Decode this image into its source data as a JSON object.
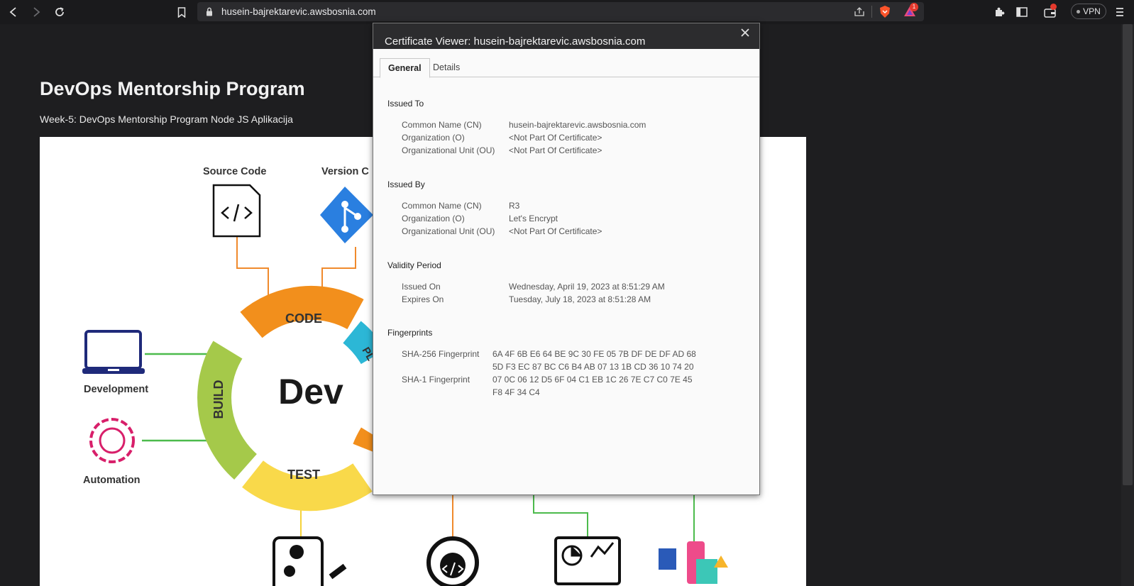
{
  "browser": {
    "url": "husein-bajrektarevic.awsbosnia.com",
    "notification_count": "1",
    "vpn_label": "VPN"
  },
  "page": {
    "title": "DevOps Mentorship Program",
    "subtitle": "Week-5: DevOps Mentorship Program Node JS Aplikacija"
  },
  "diagram": {
    "center_label": "Dev",
    "ring_labels": [
      "CODE",
      "BUILD",
      "TEST",
      "PL"
    ],
    "nodes": [
      "Source Code",
      "Version C",
      "Development",
      "Automation"
    ]
  },
  "certificate": {
    "title": "Certificate Viewer: husein-bajrektarevic.awsbosnia.com",
    "tabs": [
      "General",
      "Details"
    ],
    "issued_to": {
      "heading": "Issued To",
      "rows": [
        {
          "label": "Common Name (CN)",
          "value": "husein-bajrektarevic.awsbosnia.com"
        },
        {
          "label": "Organization (O)",
          "value": "<Not Part Of Certificate>"
        },
        {
          "label": "Organizational Unit (OU)",
          "value": "<Not Part Of Certificate>"
        }
      ]
    },
    "issued_by": {
      "heading": "Issued By",
      "rows": [
        {
          "label": "Common Name (CN)",
          "value": "R3"
        },
        {
          "label": "Organization (O)",
          "value": "Let's Encrypt"
        },
        {
          "label": "Organizational Unit (OU)",
          "value": "<Not Part Of Certificate>"
        }
      ]
    },
    "validity": {
      "heading": "Validity Period",
      "rows": [
        {
          "label": "Issued On",
          "value": "Wednesday, April 19, 2023 at 8:51:29 AM"
        },
        {
          "label": "Expires On",
          "value": "Tuesday, July 18, 2023 at 8:51:28 AM"
        }
      ]
    },
    "fingerprints": {
      "heading": "Fingerprints",
      "sha256_label": "SHA-256 Fingerprint",
      "sha256_line1": "6A 4F 6B E6 64 BE 9C 30 FE 05 7B DF DE DF AD 68",
      "sha256_line2": "5D F3 EC 87 BC C6 B4 AB 07 13 1B CD 36 10 74 20",
      "sha1_label": "SHA-1 Fingerprint",
      "sha1_line1": "07 0C 06 12 D5 6F 04 C1 EB 1C 26 7E C7 C0 7E 45",
      "sha1_line2": "F8 4F 34 C4"
    }
  }
}
